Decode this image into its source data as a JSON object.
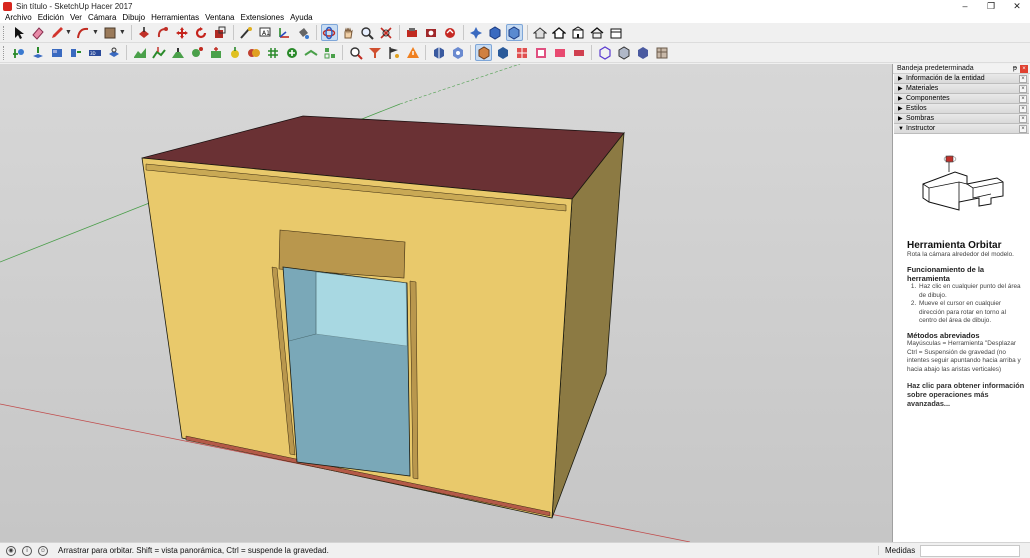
{
  "window": {
    "title": "Sin título - SketchUp Hacer 2017",
    "controls": [
      "–",
      "❐",
      "✕"
    ]
  },
  "menu": [
    "Archivo",
    "Edición",
    "Ver",
    "Cámara",
    "Dibujo",
    "Herramientas",
    "Ventana",
    "Extensiones",
    "Ayuda"
  ],
  "toolbar1": {
    "tools": [
      "select-icon",
      "eraser-icon",
      "pencil-icon",
      "arc-icon",
      "shape-icon",
      "push-pull-icon",
      "move-icon",
      "rotate-icon",
      "follow-me-icon",
      "scale-icon",
      "offset-icon",
      "tape-measure-icon",
      "text-icon",
      "axes-icon",
      "orbit-icon",
      "pan-icon",
      "zoom-icon",
      "zoom-extents-icon",
      "paint-bucket-icon",
      "components-icon",
      "styles-icon",
      "warehouse-icon",
      "iso-view-icon",
      "top-view-icon",
      "front-view-icon",
      "house-icon",
      "house-2-icon",
      "house-3-icon",
      "house-4-icon"
    ]
  },
  "toolbar2": {
    "tools": [
      "add-location-icon",
      "import-icon",
      "photo-texture-icon",
      "warehouse-share-icon",
      "extension-icon",
      "sandbox-icon",
      "terrain-icon",
      "smoove-icon",
      "stamp-icon",
      "drape-icon",
      "add-detail-icon",
      "flip-edge-icon",
      "solid-union-icon",
      "solid-intersect-icon",
      "solid-trim-icon",
      "section-plane-icon",
      "zoom-window-icon",
      "filter-icon",
      "flag-icon",
      "warning-icon",
      "view-3d-icon",
      "view-shaded-icon",
      "wireframe-icon",
      "hidden-line-icon",
      "shaded-icon",
      "textured-icon",
      "monochrome-icon",
      "xray-icon",
      "back-edges-icon",
      "camera-iso-icon",
      "camera-top-icon",
      "camera-front-icon"
    ]
  },
  "tray": {
    "title": "Bandeja predeterminada",
    "pin": "ᵽ",
    "close": "×",
    "panels": [
      {
        "label": "Información de la entidad",
        "arrow": "▶"
      },
      {
        "label": "Materiales",
        "arrow": "▶"
      },
      {
        "label": "Componentes",
        "arrow": "▶"
      },
      {
        "label": "Estilos",
        "arrow": "▶"
      },
      {
        "label": "Sombras",
        "arrow": "▶"
      },
      {
        "label": "Instructor",
        "arrow": "▼"
      }
    ],
    "instructor": {
      "title": "Herramienta Orbitar",
      "subtitle": "Rota la cámara alrededor del modelo.",
      "ops_heading": "Funcionamiento de la herramienta",
      "steps": [
        "Haz clic en cualquier punto del área de dibujo.",
        "Mueve el cursor en cualquier dirección para rotar en torno al centro del área de dibujo."
      ],
      "shortcuts_heading": "Métodos abreviados",
      "shortcuts": [
        "Mayúsculas = Herramienta \"Desplazar",
        "Ctrl = Suspensión de gravedad (no intentes seguir apuntando hacia arriba y hacia abajo las aristas verticales)"
      ],
      "more": "Haz clic para obtener información sobre operaciones más avanzadas..."
    }
  },
  "status": {
    "icons": [
      "geo-location-icon",
      "info-icon",
      "user-icon"
    ],
    "text": "Arrastrar para orbitar. Shift = vista panorámica, Ctrl = suspende la gravedad.",
    "measure_label": "Medidas",
    "measure_value": ""
  },
  "colors": {
    "roof": "#6a3134",
    "front_wall": "#e9c96b",
    "side_wall": "#8c7a43",
    "glass_dark": "#7aa8b8",
    "glass_light": "#a8d8e2",
    "axis_red": "#c94a4a",
    "axis_green": "#3f9d3f"
  }
}
